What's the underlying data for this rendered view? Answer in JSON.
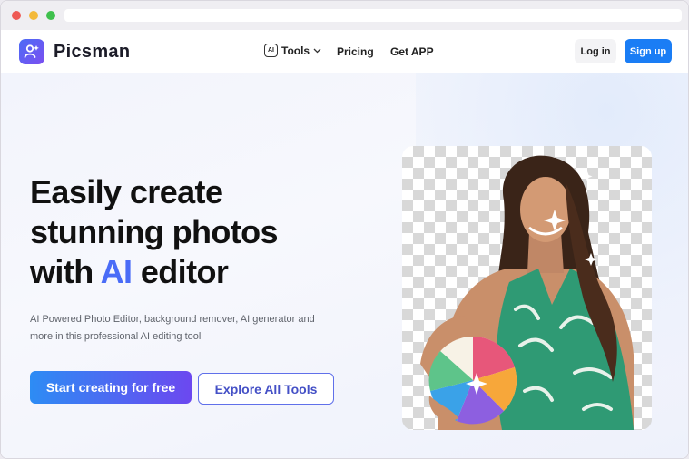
{
  "brand": {
    "name": "Picsman"
  },
  "nav": {
    "ai_badge": "AI",
    "tools": "Tools",
    "pricing": "Pricing",
    "get_app": "Get APP"
  },
  "auth": {
    "login": "Log in",
    "signup": "Sign up"
  },
  "hero": {
    "headline_line1": "Easily create",
    "headline_line2": "stunning photos",
    "headline_with": "with ",
    "headline_ai": "AI",
    "headline_rest": " editor",
    "subtext": "AI Powered Photo Editor, background remover, AI generator and more in this professional AI editing tool",
    "cta_primary": "Start creating for free",
    "cta_secondary": "Explore All Tools"
  },
  "colors": {
    "accent": "#4a6cf7",
    "signup_blue": "#1a7df5",
    "cta_gradient_start": "#2d8cf4",
    "cta_gradient_end": "#6c48f0"
  }
}
